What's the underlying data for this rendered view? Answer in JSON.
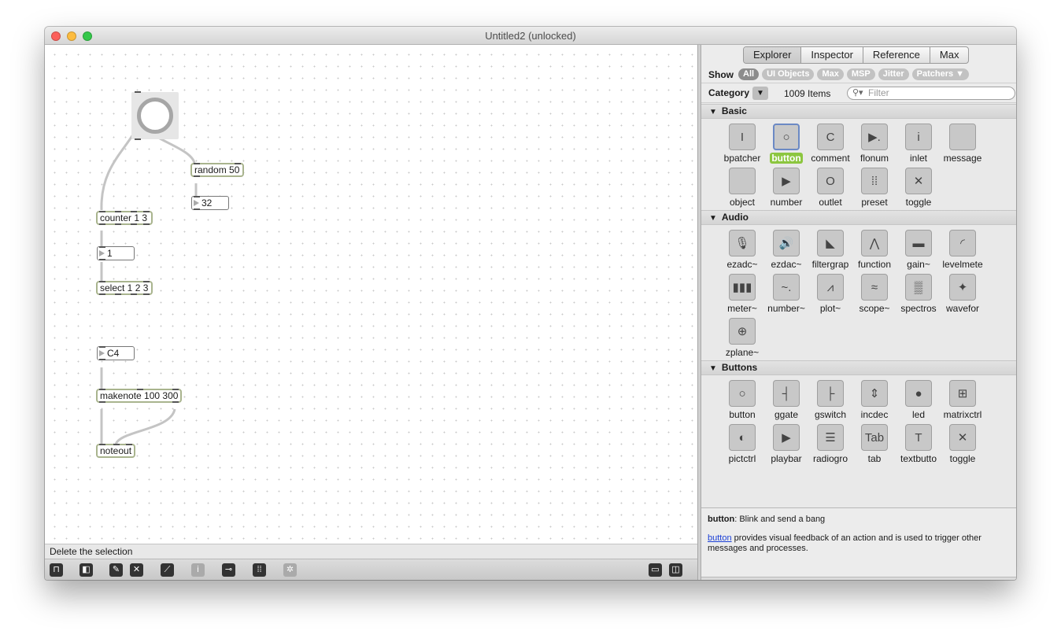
{
  "window": {
    "title": "Untitled2 (unlocked)"
  },
  "patcher": {
    "objects": {
      "random": "random 50",
      "counter": "counter 1 3",
      "select": "select 1 2 3",
      "makenote": "makenote 100 300",
      "noteout": "noteout"
    },
    "numboxes": {
      "random_out": "32",
      "counter_out": "1",
      "note": "C4"
    }
  },
  "status": {
    "message": "Delete the selection"
  },
  "toolbar": {
    "icons": [
      "lock-icon",
      "presentation-icon",
      "object-palette-icon",
      "delete-icon",
      "debug-icon",
      "info-icon",
      "slider-icon",
      "grid-icon",
      "snapshot-icon"
    ],
    "right_icons": [
      "layout-bottom-icon",
      "layout-side-icon"
    ]
  },
  "sidebar": {
    "tabs": [
      {
        "label": "Explorer",
        "active": true
      },
      {
        "label": "Inspector",
        "active": false
      },
      {
        "label": "Reference",
        "active": false
      },
      {
        "label": "Max",
        "active": false
      }
    ],
    "show": {
      "label": "Show",
      "filters": [
        {
          "label": "All",
          "active": true
        },
        {
          "label": "UI Objects",
          "active": false
        },
        {
          "label": "Max",
          "active": false
        },
        {
          "label": "MSP",
          "active": false
        },
        {
          "label": "Jitter",
          "active": false
        },
        {
          "label": "Patchers ▼",
          "active": false
        }
      ]
    },
    "category": {
      "label": "Category",
      "dropdown": "▼",
      "count": "1009 Items",
      "filter_placeholder": "Filter"
    },
    "sections": [
      {
        "title": "Basic",
        "items": [
          {
            "label": "bpatcher",
            "icon": "I"
          },
          {
            "label": "button",
            "icon": "○",
            "selected": true
          },
          {
            "label": "comment",
            "icon": "C"
          },
          {
            "label": "flonum",
            "icon": "▶."
          },
          {
            "label": "inlet",
            "icon": "i"
          },
          {
            "label": "message",
            "icon": ""
          },
          {
            "label": "object",
            "icon": ""
          },
          {
            "label": "number",
            "icon": "▶"
          },
          {
            "label": "outlet",
            "icon": "O"
          },
          {
            "label": "preset",
            "icon": "⁞⁞"
          },
          {
            "label": "toggle",
            "icon": "✕"
          }
        ]
      },
      {
        "title": "Audio",
        "items": [
          {
            "label": "ezadc~",
            "icon": "🎙"
          },
          {
            "label": "ezdac~",
            "icon": "🔊"
          },
          {
            "label": "filtergrap",
            "icon": "◣"
          },
          {
            "label": "function",
            "icon": "⋀"
          },
          {
            "label": "gain~",
            "icon": "▬"
          },
          {
            "label": "levelmete",
            "icon": "◜"
          },
          {
            "label": "meter~",
            "icon": "▮▮▮"
          },
          {
            "label": "number~",
            "icon": "~."
          },
          {
            "label": "plot~",
            "icon": "⩘"
          },
          {
            "label": "scope~",
            "icon": "≈"
          },
          {
            "label": "spectros",
            "icon": "▒"
          },
          {
            "label": "wavefor",
            "icon": "✦"
          },
          {
            "label": "zplane~",
            "icon": "⊕"
          }
        ]
      },
      {
        "title": "Buttons",
        "items": [
          {
            "label": "button",
            "icon": "○"
          },
          {
            "label": "ggate",
            "icon": "┤"
          },
          {
            "label": "gswitch",
            "icon": "├"
          },
          {
            "label": "incdec",
            "icon": "⇕"
          },
          {
            "label": "led",
            "icon": "●"
          },
          {
            "label": "matrixctrl",
            "icon": "⊞"
          },
          {
            "label": "pictctrl",
            "icon": "◐"
          },
          {
            "label": "playbar",
            "icon": "▶"
          },
          {
            "label": "radiogro",
            "icon": "☰"
          },
          {
            "label": "tab",
            "icon": "Tab"
          },
          {
            "label": "textbutto",
            "icon": "T"
          },
          {
            "label": "toggle",
            "icon": "✕"
          }
        ]
      }
    ],
    "description": {
      "name": "button",
      "short": ": Blink and send a bang",
      "link": "button",
      "long": " provides visual feedback of an action and is used to trigger other messages and processes."
    },
    "toolbar_icons": [
      "gear-icon",
      "grid-view-icon",
      "list-view-icon",
      "eye-icon",
      "add-icon",
      "help-icon",
      "menu-icon"
    ]
  }
}
